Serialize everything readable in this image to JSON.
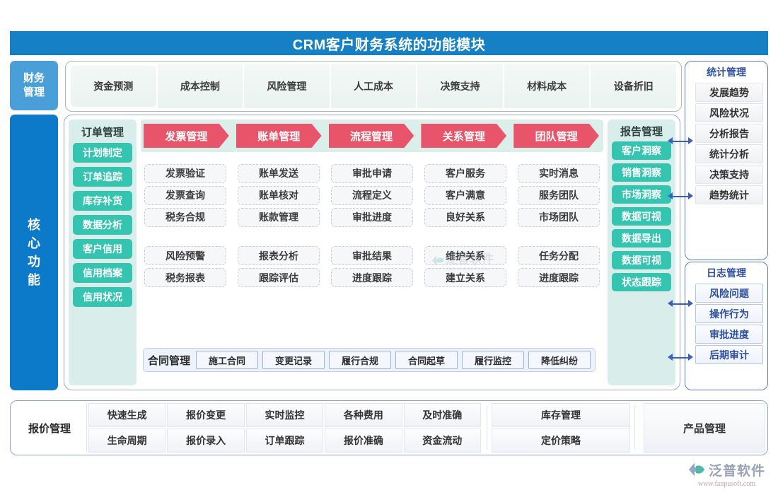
{
  "header": {
    "title": "CRM客户财务系统的功能模块",
    "accent": "#1680c4"
  },
  "finance": {
    "label_line1": "财务",
    "label_line2": "管理",
    "items": [
      "资金预测",
      "成本控制",
      "风险管理",
      "人工成本",
      "决策支持",
      "材料成本",
      "设备折旧"
    ]
  },
  "core": {
    "label": "核心功能",
    "label_chars": [
      "核",
      "心",
      "功",
      "能"
    ],
    "order": {
      "title": "订单管理",
      "items": [
        "计划制定",
        "订单追踪",
        "库存补货",
        "数据分析",
        "客户信用",
        "信用档案",
        "信用状况"
      ]
    },
    "columns": [
      {
        "banner": "发票管理",
        "top": [
          "发票验证",
          "发票查询",
          "税务合规"
        ],
        "bottom": [
          "风险预警",
          "税务报表"
        ]
      },
      {
        "banner": "账单管理",
        "top": [
          "账单发送",
          "账单核对",
          "账款管理"
        ],
        "bottom": [
          "报表分析",
          "跟踪评估"
        ]
      },
      {
        "banner": "流程管理",
        "top": [
          "审批申请",
          "流程定义",
          "审批进度"
        ],
        "bottom": [
          "审批结果",
          "进度跟踪"
        ]
      },
      {
        "banner": "关系管理",
        "top": [
          "客户服务",
          "客户满意",
          "良好关系"
        ],
        "bottom": [
          "维护关系",
          "建立关系"
        ]
      },
      {
        "banner": "团队管理",
        "top": [
          "实时消息",
          "服务团队",
          "市场团队"
        ],
        "bottom": [
          "任务分配",
          "进度跟踪"
        ]
      }
    ],
    "report": {
      "title": "报告管理",
      "items": [
        "客户洞察",
        "销售洞察",
        "市场洞察",
        "数据可视",
        "数据导出",
        "数据可视",
        "状态跟踪"
      ]
    },
    "contract": {
      "title": "合同管理",
      "items": [
        "施工合同",
        "变更记录",
        "履行合规",
        "合同起草",
        "履行监控",
        "降低纠纷"
      ]
    }
  },
  "statistics": {
    "title": "统计管理",
    "items": [
      "发展趋势",
      "风险状况",
      "分析报告",
      "统计分析",
      "决策支持",
      "趋势统计"
    ]
  },
  "log": {
    "title": "日志管理",
    "items": [
      "风险问题",
      "操作行为",
      "审批进度",
      "后期审计"
    ]
  },
  "quote": {
    "label": "报价管理",
    "row1": [
      "快速生成",
      "报价变更",
      "实时监控",
      "各种费用",
      "及时准确"
    ],
    "row2": [
      "生命周期",
      "报价录入",
      "订单跟踪",
      "报价准确",
      "资金流动"
    ],
    "inventory": [
      "库存管理",
      "定价策略"
    ],
    "product": "产品管理"
  },
  "brand": {
    "name": "泛普软件",
    "url": "www.fanpusoft.com"
  },
  "colors": {
    "title_blue": "#1680c4",
    "finance_blue": "#4a9fd8",
    "core_blue": "#0d79c9",
    "teal": "#35c4b0",
    "red": "#e8556b",
    "panel_border": "#5a7fc0",
    "arrow": "#3a5fc0"
  }
}
